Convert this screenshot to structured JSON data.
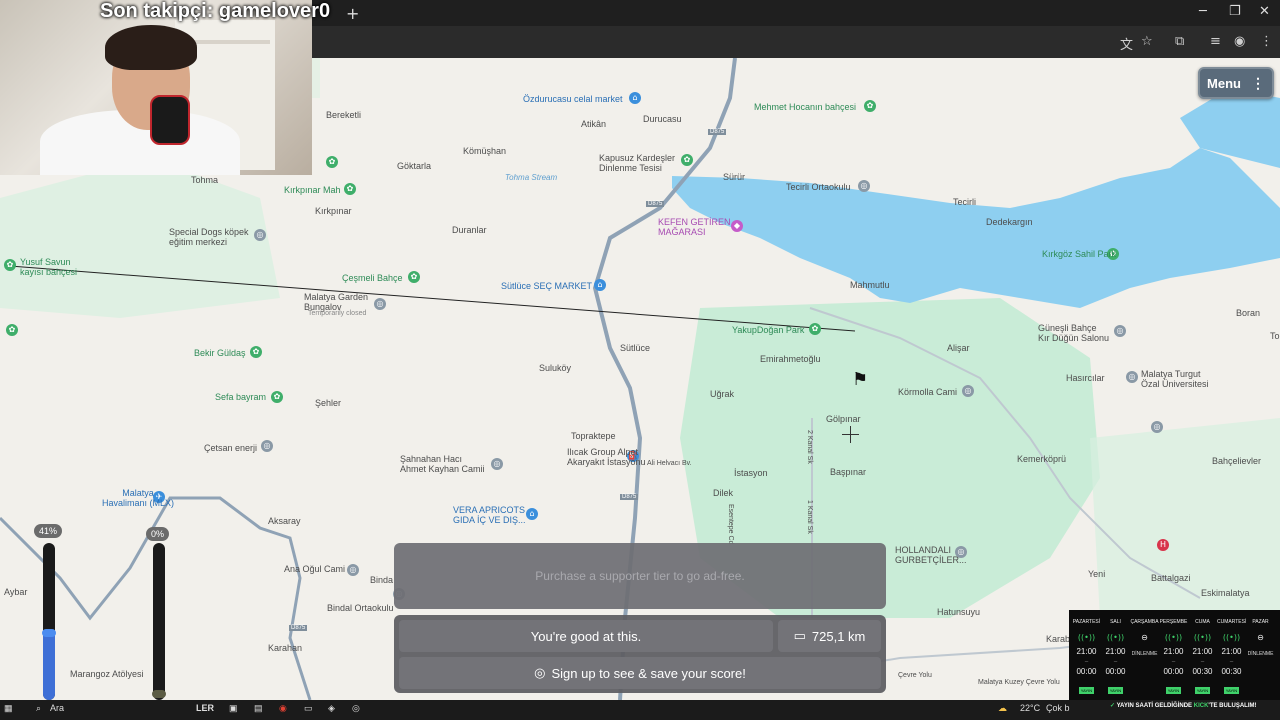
{
  "browser": {
    "new_tab_icon": "plus-icon",
    "window_controls": [
      "minimize-icon",
      "restore-icon",
      "close-icon"
    ],
    "toolbar_icons": [
      "translate-icon",
      "star-icon",
      "extensions-icon",
      "media-icon",
      "profile-icon",
      "more-icon"
    ]
  },
  "stream": {
    "follower_text": "Son takipçi: gamelover0"
  },
  "map": {
    "menu_label": "Menu",
    "labels": {
      "bereketli": "Bereketli",
      "ozdurucasu": "Özdurucasu celal market",
      "atikan": "Atikân",
      "durucasu": "Durucasu",
      "mehmet": "Mehmet Hocanın bahçesi",
      "komushan": "Kömüşhan",
      "kapusuz": "Kapusuz Kardeşler\nDinlenme Tesisi",
      "sürür": "Sürür",
      "tecirli_okul": "Tecirli Ortaokulu",
      "goktarla": "Göktarla",
      "tohma": "Tohma",
      "tohma_stream": "Tohma Stream",
      "kirkpinar_mah": "Kırkpınar Mah",
      "kirkpinar": "Kırkpınar",
      "tecirli": "Tecirli",
      "dedekargin": "Dedekargın",
      "kefen": "KEFEN GETİREN\nMAĞARASI",
      "special_dogs": "Special Dogs köpek\neğitim merkezi",
      "duranlar": "Duranlar",
      "kirkgoz": "Kırkgöz Sahil Park",
      "yusuf": "Yusuf Savun\nkayısı bahçesi",
      "cesmeli": "Çeşmeli Bahçe",
      "sutluce_market": "Sütlüce SEÇ MARKET",
      "mahmutlu": "Mahmutlu",
      "malatya_garden": "Malatya Garden\nBungalov",
      "temp_closed": "Temporarily closed",
      "boran": "Boran",
      "yakup": "YakupDoğan Park",
      "guneşli": "Güneşli Bahçe\nKır Düğün Salonu",
      "bekir": "Bekir Güldaş",
      "sutluce": "Sütlüce",
      "emirahmetoglu": "Emirahmetoğlu",
      "alisar": "Alişar",
      "suluköy": "Suluköy",
      "hasircilar": "Hasırcılar",
      "turgut": "Malatya Turgut\nÖzal Üniversitesi",
      "sefa": "Sefa bayram",
      "sehler": "Şehler",
      "ugrak": "Uğrak",
      "kormolla": "Körmolla Cami",
      "golpinar": "Gölpınar",
      "cetsan": "Çetsan enerji",
      "topraktepe": "Topraktepe",
      "kanal2": "2 Kanal Sk",
      "sahnahan": "Şahnahan Hacı\nAhmet Kayhan Camii",
      "ilicak": "Ilıcak Group Alpet\nAkaryakıt İstasyonu",
      "ali_helvaci": "Ali Helvacı Bv.",
      "istasyon": "İstasyon",
      "baspinar": "Başpınar",
      "kemerkopru": "Kemerköprü",
      "bahcelievler": "Bahçelievler",
      "havalimani": "Malatya\nHavalimanı (MLX)",
      "dilek": "Dilek",
      "vera": "VERA APRICOTS\nGIDA İÇ VE DIŞ...",
      "aksaray": "Aksaray",
      "kanal1": "1 Kanal Sk",
      "esentepe": "Esentepe Cd",
      "hollandali": "HOLLANDALI\nGURBETÇİLER...",
      "yeni": "Yeni",
      "battalgazi": "Battalgazi",
      "eskimalatya": "Eskimalatya",
      "aybar": "Aybar",
      "ana_ogul": "Ana Oğul Cami",
      "binda": "Binda",
      "bindal_okul": "Bindal Ortaokulu",
      "hatunsuyu": "Hatunsuyu",
      "karahan": "Karahan",
      "karab": "Karab",
      "marangoz": "Marangoz Atölyesi",
      "cevre_yolu": "Malatya Kuzey Çevre Yolu",
      "cevre_yolu2": "Çevre Yolu",
      "d875a": "D875",
      "d875b": "D875",
      "d875c": "D875",
      "d875d": "D875",
      "to": "To"
    }
  },
  "meters": [
    {
      "pct_label": "41%",
      "level": 0.41
    },
    {
      "pct_label": "0%",
      "level": 0.0
    }
  ],
  "game": {
    "ad_text": "Purchase a supporter tier to go ad-free.",
    "result_text": "You're good at this.",
    "distance": "725,1 km",
    "signup_text": "Sign up to see & save your score!"
  },
  "schedule": {
    "days": [
      {
        "day": "PAZARTESİ",
        "start": "21:00",
        "end": "00:00",
        "live": true
      },
      {
        "day": "SALI",
        "start": "21:00",
        "end": "00:00",
        "live": true
      },
      {
        "day": "ÇARŞAMBA",
        "rest": "DİNLENME",
        "live": false
      },
      {
        "day": "PERŞEMBE",
        "start": "21:00",
        "end": "00:00",
        "live": true
      },
      {
        "day": "CUMA",
        "start": "21:00",
        "end": "00:30",
        "live": true
      },
      {
        "day": "CUMARTESİ",
        "start": "21:00",
        "end": "00:30",
        "live": true
      },
      {
        "day": "PAZAR",
        "rest": "DİNLENME",
        "live": false
      }
    ],
    "tag": "YAYIN",
    "banner_pre": "YAYIN SAATİ GELDİĞİNDE",
    "banner_kick": "KICK",
    "banner_post": "'TE BULUŞALIM!"
  },
  "taskbar": {
    "search_text": "Ara",
    "weather": "22°C",
    "weather_desc": "Çok b",
    "partial_text": "LER"
  }
}
